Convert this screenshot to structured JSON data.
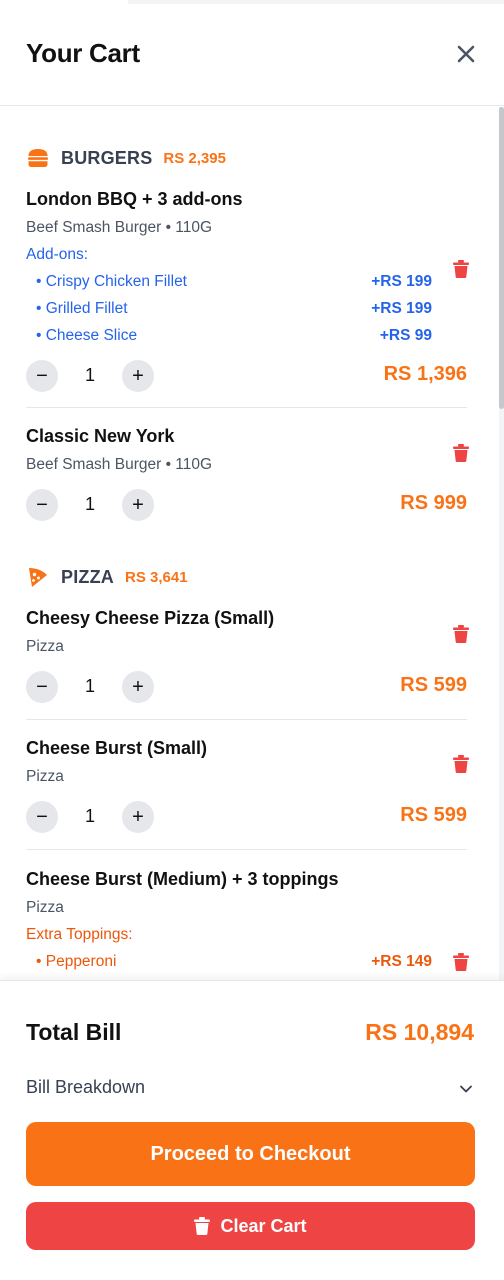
{
  "header": {
    "title": "Your Cart",
    "close_icon": "close-icon"
  },
  "categories": [
    {
      "name": "BURGERS",
      "total": "RS 2,395",
      "icon": "burger-icon",
      "items": [
        {
          "name": "London BBQ + 3 add-ons",
          "subtitle": "Beef Smash Burger • 110G",
          "addons_label": "Add-ons:",
          "addons": [
            {
              "name": "Crispy Chicken Fillet",
              "price": "+RS 199"
            },
            {
              "name": "Grilled Fillet",
              "price": "+RS 199"
            },
            {
              "name": "Cheese Slice",
              "price": "+RS 99"
            }
          ],
          "qty": "1",
          "price": "RS 1,396"
        },
        {
          "name": "Classic New York",
          "subtitle": "Beef Smash Burger • 110G",
          "qty": "1",
          "price": "RS 999"
        }
      ]
    },
    {
      "name": "PIZZA",
      "total": "RS 3,641",
      "icon": "pizza-icon",
      "items": [
        {
          "name": "Cheesy Cheese Pizza (Small)",
          "subtitle": "Pizza",
          "qty": "1",
          "price": "RS 599"
        },
        {
          "name": "Cheese Burst (Small)",
          "subtitle": "Pizza",
          "qty": "1",
          "price": "RS 599"
        },
        {
          "name": "Cheese Burst (Medium) + 3 toppings",
          "subtitle": "Pizza",
          "toppings_label": "Extra Toppings:",
          "toppings": [
            {
              "name": "Pepperoni",
              "price": "+RS 149"
            }
          ]
        }
      ]
    }
  ],
  "qty_controls": {
    "minus": "−",
    "plus": "+"
  },
  "footer": {
    "total_label": "Total Bill",
    "total_value": "RS 10,894",
    "breakdown_label": "Bill Breakdown",
    "checkout_label": "Proceed to Checkout",
    "clear_label": "Clear Cart"
  },
  "colors": {
    "accent": "#f97316",
    "danger": "#ef4444",
    "addon_blue": "#2563eb",
    "topping_orange": "#ea580c"
  }
}
